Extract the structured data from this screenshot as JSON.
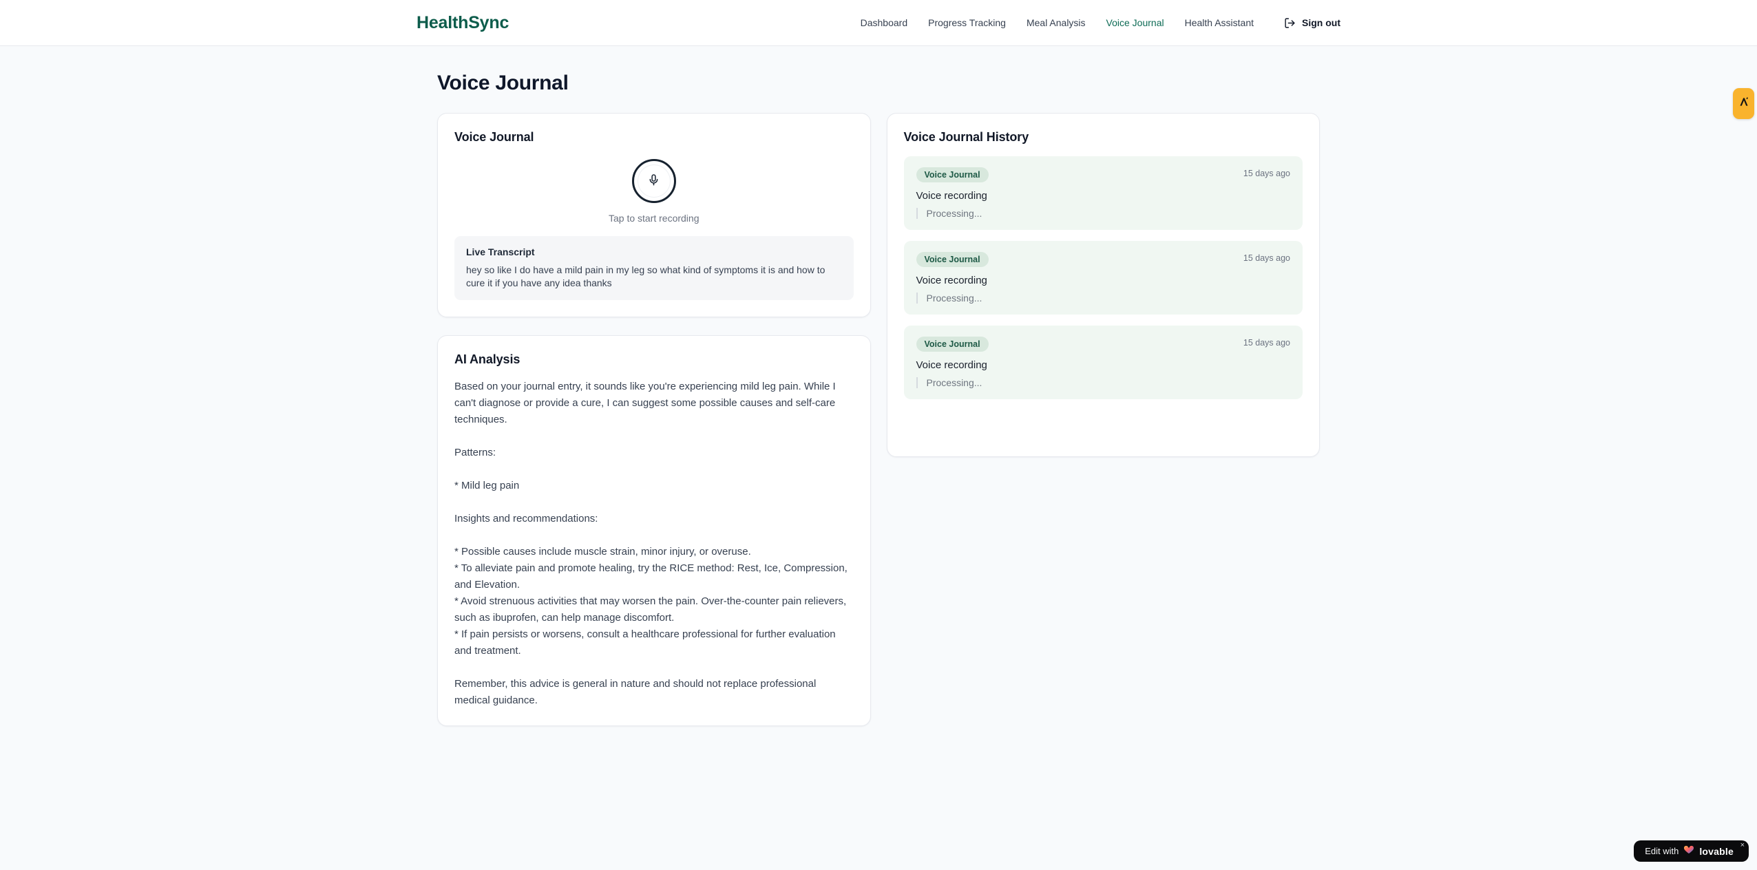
{
  "brand": {
    "name": "HealthSync"
  },
  "nav": {
    "items": [
      {
        "label": "Dashboard",
        "active": false
      },
      {
        "label": "Progress Tracking",
        "active": false
      },
      {
        "label": "Meal Analysis",
        "active": false
      },
      {
        "label": "Voice Journal",
        "active": true
      },
      {
        "label": "Health Assistant",
        "active": false
      }
    ],
    "sign_out_label": "Sign out"
  },
  "page": {
    "title": "Voice Journal"
  },
  "recorder_card": {
    "title": "Voice Journal",
    "tap_hint": "Tap to start recording",
    "transcript_title": "Live Transcript",
    "transcript_text": "hey so like I do have a mild pain in my leg so what kind of symptoms it is and how to cure it if you have any idea thanks"
  },
  "analysis_card": {
    "title": "AI Analysis",
    "content": "Based on your journal entry, it sounds like you're experiencing mild leg pain. While I can't diagnose or provide a cure, I can suggest some possible causes and self-care techniques.\n\nPatterns:\n\n* Mild leg pain\n\nInsights and recommendations:\n\n* Possible causes include muscle strain, minor injury, or overuse.\n* To alleviate pain and promote healing, try the RICE method: Rest, Ice, Compression, and Elevation.\n* Avoid strenuous activities that may worsen the pain. Over-the-counter pain relievers, such as ibuprofen, can help manage discomfort.\n* If pain persists or worsens, consult a healthcare professional for further evaluation and treatment.\n\nRemember, this advice is general in nature and should not replace professional medical guidance."
  },
  "history_card": {
    "title": "Voice Journal History",
    "entries": [
      {
        "badge": "Voice Journal",
        "time": "15 days ago",
        "title": "Voice recording",
        "status": "Processing..."
      },
      {
        "badge": "Voice Journal",
        "time": "15 days ago",
        "title": "Voice recording",
        "status": "Processing..."
      },
      {
        "badge": "Voice Journal",
        "time": "15 days ago",
        "title": "Voice recording",
        "status": "Processing..."
      }
    ]
  },
  "overlays": {
    "lovable": {
      "prefix": "Edit with",
      "brand": "lovable",
      "close": "×"
    }
  },
  "colors": {
    "brand_green": "#0d5c4b",
    "nav_active_green": "#0d6b55",
    "page_background": "#f8fafc",
    "history_item_background": "#f0f7f2",
    "badge_background": "#d8e8dd",
    "badge_text": "#1d5945",
    "extension_tab_amber": "#f9b32d",
    "lovable_black": "#0b0b0d"
  }
}
